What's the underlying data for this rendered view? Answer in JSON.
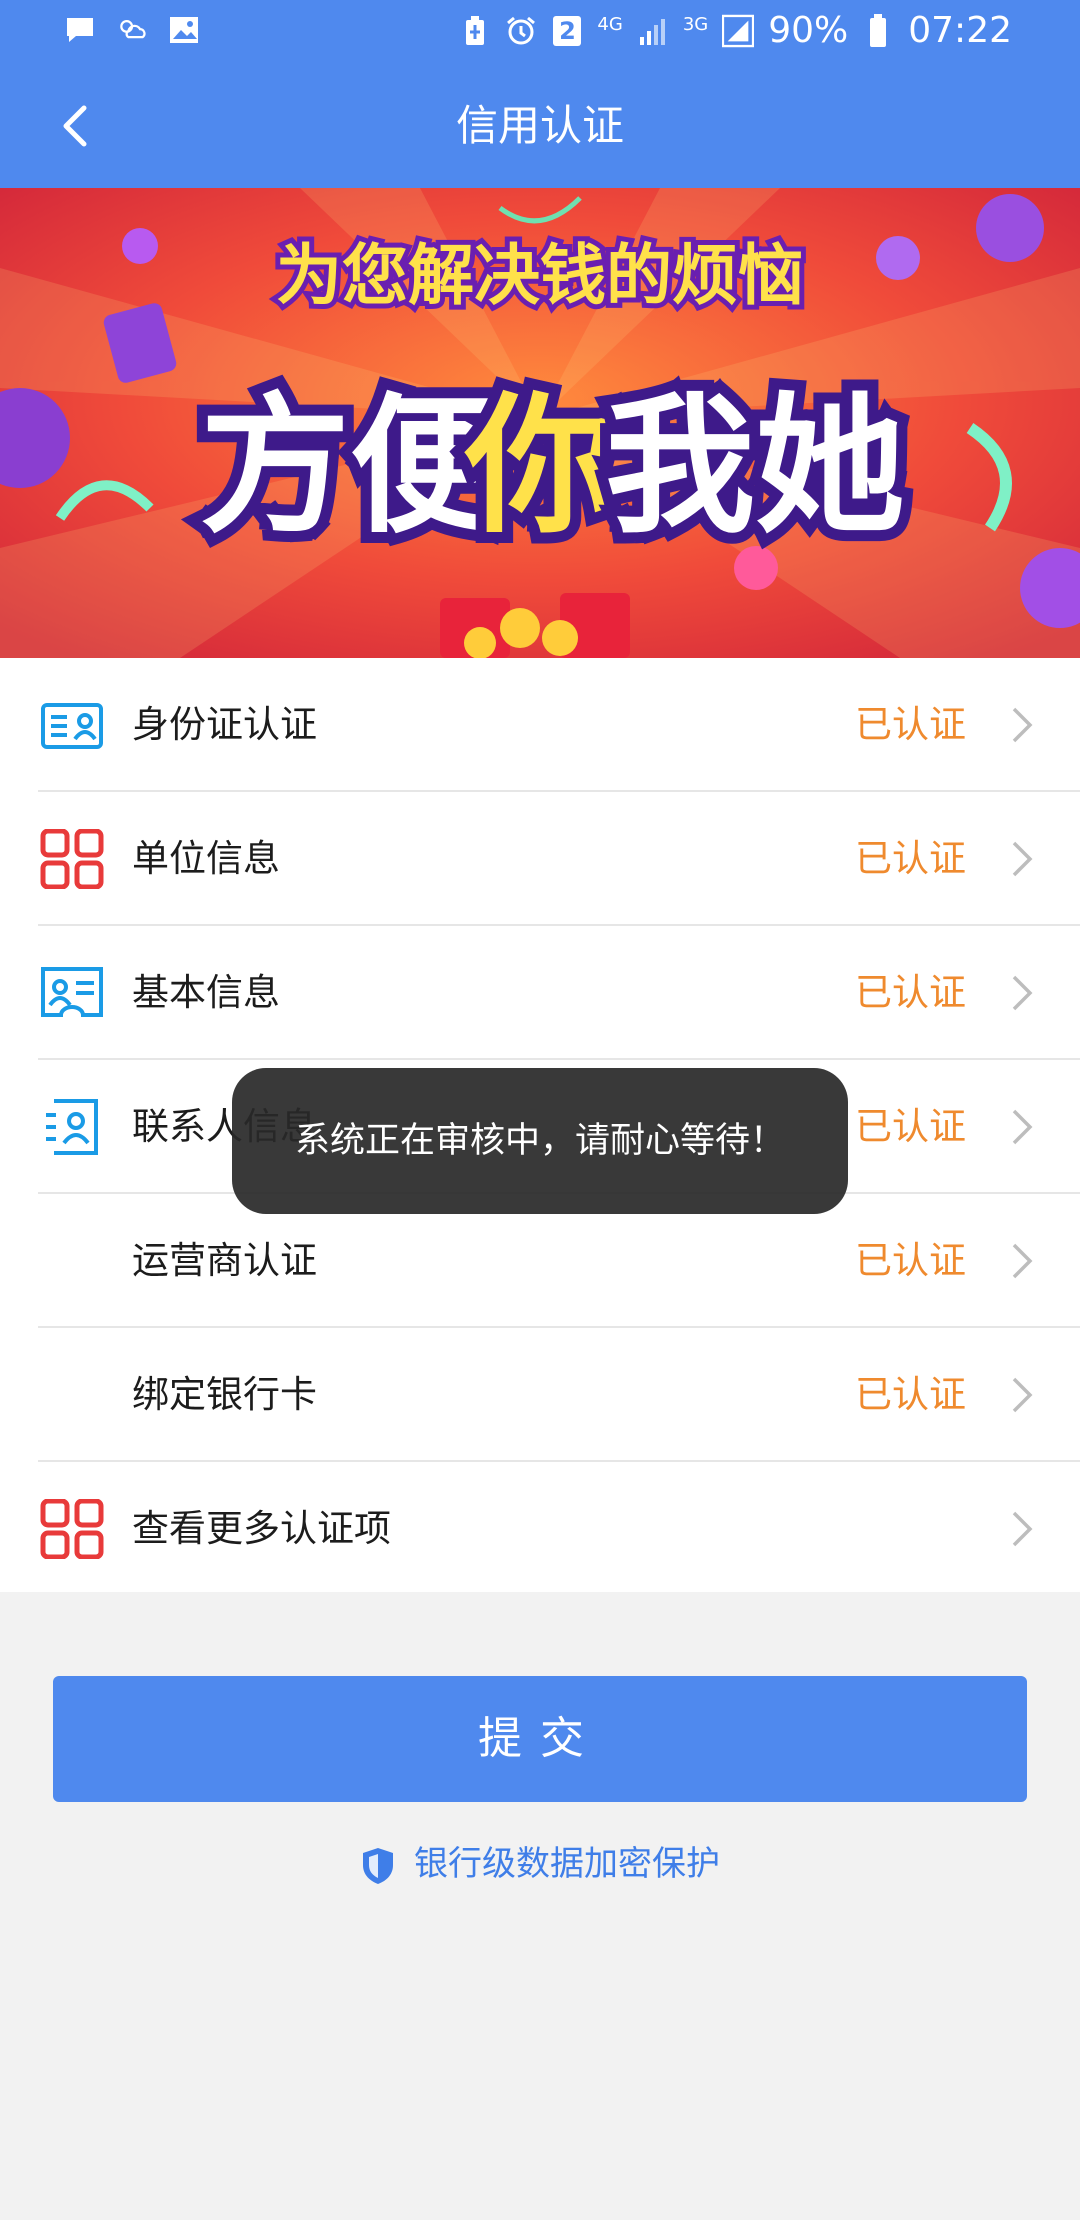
{
  "status_bar": {
    "battery_percent": "90%",
    "time": "07:22",
    "sim_badge": "2",
    "network_4g": "4G",
    "network_3g": "3G",
    "left_icons": [
      "message-icon",
      "weather-icon",
      "image-icon"
    ],
    "right_icons": [
      "battery-saver-icon",
      "alarm-icon",
      "sim-icon",
      "signal-4g-icon",
      "signal-3g-icon",
      "battery-icon"
    ]
  },
  "app_bar": {
    "title": "信用认证",
    "back_icon": "chevron-left-icon",
    "color": "#4f89ee"
  },
  "banner": {
    "headline": "为您解决钱的烦恼",
    "slogan_part1": "方便",
    "slogan_part2": "你",
    "slogan_part3": "我她"
  },
  "list": {
    "items": [
      {
        "label": "身份证认证",
        "status": "已认证",
        "icon": "id-card-icon"
      },
      {
        "label": "单位信息",
        "status": "已认证",
        "icon": "grid-icon"
      },
      {
        "label": "基本信息",
        "status": "已认证",
        "icon": "profile-card-icon"
      },
      {
        "label": "联系人信息",
        "status": "已认证",
        "icon": "contact-icon"
      },
      {
        "label": "运营商认证",
        "status": "已认证",
        "icon": ""
      },
      {
        "label": "绑定银行卡",
        "status": "已认证",
        "icon": ""
      },
      {
        "label": "查看更多认证项",
        "status": "",
        "icon": "grid-icon"
      }
    ],
    "status_color": "#ef8a2e"
  },
  "submit": {
    "label": "提交"
  },
  "secure_note": {
    "text": "银行级数据加密保护",
    "icon": "shield-icon"
  },
  "toast": {
    "text": "系统正在审核中，请耐心等待！"
  }
}
